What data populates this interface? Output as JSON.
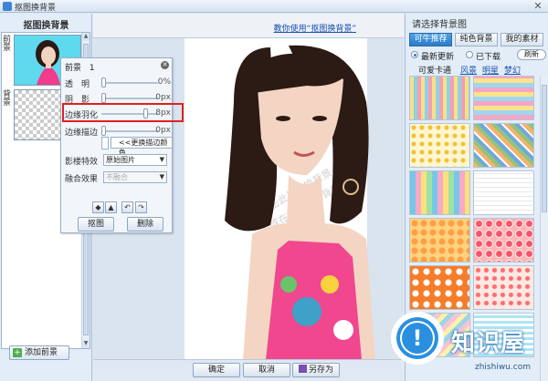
{
  "window": {
    "title": "抠图换背景",
    "close_glyph": "✕"
  },
  "left_pane": {
    "title": "抠图换背景",
    "layers": [
      {
        "tag": "前景",
        "kind": "foreground"
      },
      {
        "tag": "背景",
        "kind": "background"
      }
    ],
    "add_foreground_label": "添加前景",
    "add_foreground_icon": "+"
  },
  "main": {
    "tutorial_link": "教你使用“抠图换背景”",
    "watermarks": [
      "双击此处更换背景",
      "或在右侧选择背景"
    ],
    "buttons": {
      "ok": "确定",
      "cancel": "取消",
      "save_as": "另存为"
    }
  },
  "props_panel": {
    "title": "前景",
    "number": "1",
    "close_glyph": "✕",
    "rows": [
      {
        "label": "透　明",
        "value": "0%",
        "level": 0
      },
      {
        "label": "阴　影",
        "value": "0px",
        "level": 0
      },
      {
        "label": "边缘羽化",
        "value": "8px",
        "level": 0.8
      },
      {
        "label": "边缘描边",
        "value": "0px",
        "level": 0
      }
    ],
    "stroke_color_button": "<<更换描边颜色",
    "shadow_effect": {
      "label": "影楼特效",
      "selected": "原始图片"
    },
    "blend_effect": {
      "label": "融合效果",
      "selected": "不融合"
    },
    "tools": [
      "◆",
      "▲",
      "↶",
      "↷"
    ],
    "cutout_button": "抠图",
    "delete_button": "删除"
  },
  "right_pane": {
    "title": "请选择背景图",
    "tabs": [
      "可牛推荐",
      "纯色背景",
      "我的素材"
    ],
    "active_tab": 0,
    "radios": [
      "最新更新",
      "已下载"
    ],
    "refresh_label": "刷新",
    "categories": [
      "可爱卡通",
      "风景",
      "明星",
      "梦幻"
    ]
  },
  "brand": {
    "name": "知识屋",
    "url": "zhishiwu.com",
    "icon_letter": "!"
  },
  "colors": {
    "accent": "#2b7bc8",
    "highlight": "#e02020",
    "link": "#1a4fb0"
  }
}
